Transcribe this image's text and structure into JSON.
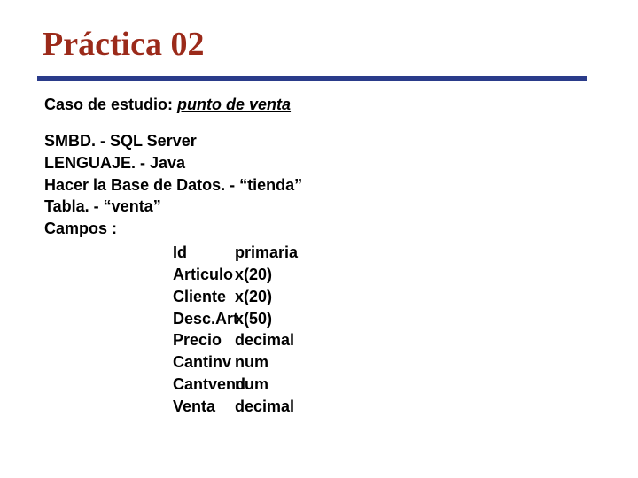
{
  "slide": {
    "title": "Práctica 02",
    "subtitle_prefix": "Caso de estudio:",
    "subtitle_emph": "punto de venta",
    "lines": [
      "SMBD. - SQL Server",
      "LENGUAJE. - Java",
      "Hacer la Base de Datos. -  “tienda”",
      "Tabla. - “venta”",
      "Campos :"
    ],
    "fields": [
      {
        "name": "Id",
        "type": "primaria"
      },
      {
        "name": "Articulo",
        "type": "x(20)"
      },
      {
        "name": "Cliente",
        "type": "x(20)"
      },
      {
        "name": "Desc.Art",
        "type": "x(50)"
      },
      {
        "name": "Precio",
        "type": "decimal"
      },
      {
        "name": "Cantinv",
        "type": "num"
      },
      {
        "name": "Cantvend",
        "type": "num"
      },
      {
        "name": "Venta",
        "type": "decimal"
      }
    ]
  }
}
